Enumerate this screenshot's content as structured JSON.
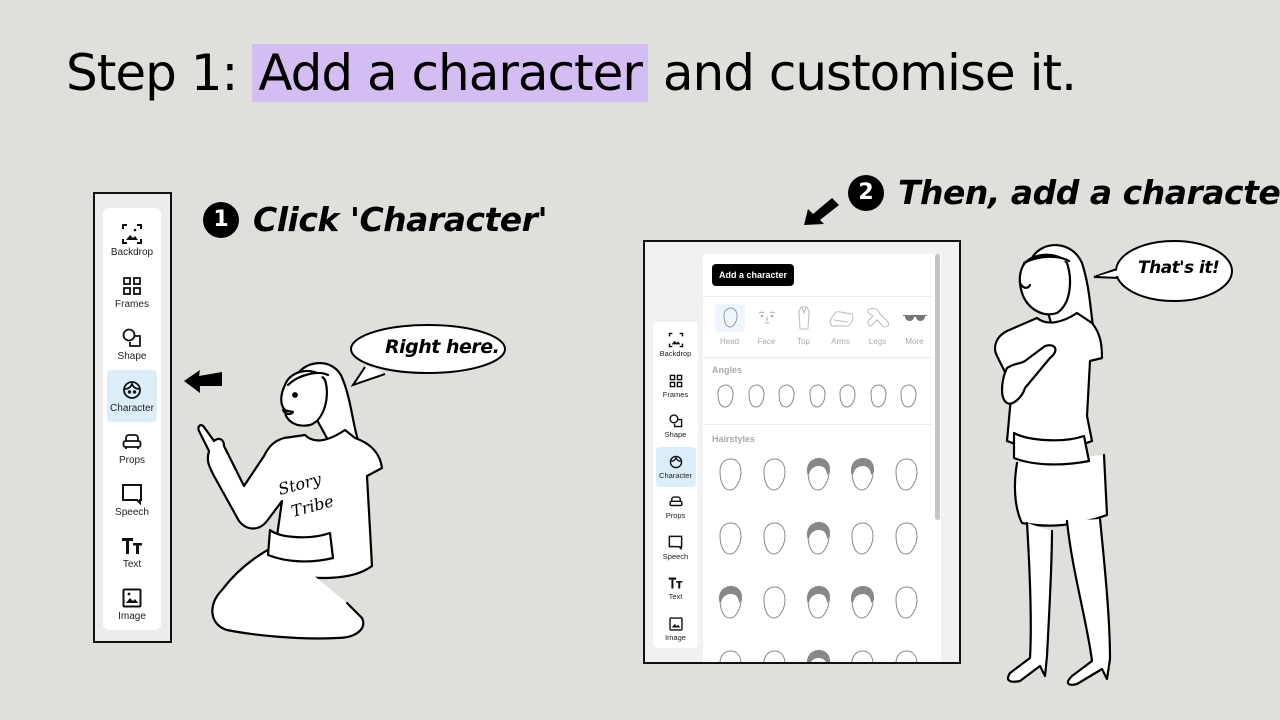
{
  "title": {
    "prefix": "Step 1:",
    "highlight": "Add a character",
    "suffix": "and customise it.",
    "highlight_color": "#d4bdf3"
  },
  "steps": [
    {
      "number": "1",
      "text": "Click 'Character'"
    },
    {
      "number": "2",
      "text": "Then, add a character"
    }
  ],
  "bubbles": [
    {
      "text": "Right here."
    },
    {
      "text": "That's it!"
    }
  ],
  "sidebar": {
    "items": [
      {
        "label": "Backdrop",
        "icon": "backdrop-icon",
        "active": false
      },
      {
        "label": "Frames",
        "icon": "frames-icon",
        "active": false
      },
      {
        "label": "Shape",
        "icon": "shape-icon",
        "active": false
      },
      {
        "label": "Character",
        "icon": "character-icon",
        "active": true
      },
      {
        "label": "Props",
        "icon": "props-icon",
        "active": false
      },
      {
        "label": "Speech",
        "icon": "speech-icon",
        "active": false
      },
      {
        "label": "Text",
        "icon": "text-icon",
        "active": false
      },
      {
        "label": "Image",
        "icon": "image-icon",
        "active": false
      }
    ],
    "active_color": "#dcedfa"
  },
  "character_panel": {
    "add_button": "Add a character",
    "categories": [
      {
        "label": "Head",
        "active": true
      },
      {
        "label": "Face",
        "active": false
      },
      {
        "label": "Top",
        "active": false
      },
      {
        "label": "Arms",
        "active": false
      },
      {
        "label": "Legs",
        "active": false
      },
      {
        "label": "More",
        "active": false
      }
    ],
    "sections": [
      {
        "label": "Angles",
        "count": 7
      },
      {
        "label": "Hairstyles",
        "count": 20
      }
    ]
  }
}
